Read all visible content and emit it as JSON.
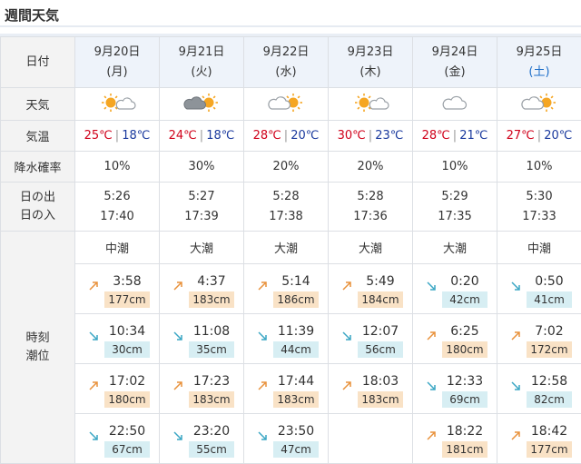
{
  "page": {
    "title": "週間天気"
  },
  "labels": {
    "date": "日付",
    "weather": "天気",
    "temp": "気温",
    "rain": "降水確率",
    "sunrise": "日の出",
    "sunset": "日の入",
    "tide_time": "時刻",
    "tide_level": "潮位"
  },
  "colors": {
    "high_temp": "#d0021b",
    "low_temp": "#1b3a9e",
    "saturday": "#1e6fc9",
    "high_tide_bg": "#f9e2c6",
    "low_tide_bg": "#d7eef3"
  },
  "days": [
    {
      "date": "9月20日",
      "dow": "(月)",
      "weather_icon": "sun-cloud-icon",
      "high": "25℃",
      "low": "18℃",
      "rain": "10%",
      "sunrise": "5:26",
      "sunset": "17:40",
      "tide_name": "中潮",
      "tides": [
        {
          "time": "3:58",
          "level": "177cm",
          "dir": "up"
        },
        {
          "time": "10:34",
          "level": "30cm",
          "dir": "down"
        },
        {
          "time": "17:02",
          "level": "180cm",
          "dir": "up"
        },
        {
          "time": "22:50",
          "level": "67cm",
          "dir": "down"
        }
      ]
    },
    {
      "date": "9月21日",
      "dow": "(火)",
      "weather_icon": "cloud-sun-icon",
      "high": "24℃",
      "low": "18℃",
      "rain": "30%",
      "sunrise": "5:27",
      "sunset": "17:39",
      "tide_name": "大潮",
      "tides": [
        {
          "time": "4:37",
          "level": "183cm",
          "dir": "up"
        },
        {
          "time": "11:08",
          "level": "35cm",
          "dir": "down"
        },
        {
          "time": "17:23",
          "level": "183cm",
          "dir": "up"
        },
        {
          "time": "23:20",
          "level": "55cm",
          "dir": "down"
        }
      ]
    },
    {
      "date": "9月22日",
      "dow": "(水)",
      "weather_icon": "cloud-sun-icon",
      "high": "28℃",
      "low": "20℃",
      "rain": "20%",
      "sunrise": "5:28",
      "sunset": "17:38",
      "tide_name": "大潮",
      "tides": [
        {
          "time": "5:14",
          "level": "186cm",
          "dir": "up"
        },
        {
          "time": "11:39",
          "level": "44cm",
          "dir": "down"
        },
        {
          "time": "17:44",
          "level": "183cm",
          "dir": "up"
        },
        {
          "time": "23:50",
          "level": "47cm",
          "dir": "down"
        }
      ]
    },
    {
      "date": "9月23日",
      "dow": "(木)",
      "weather_icon": "sun-cloud-icon",
      "high": "30℃",
      "low": "23℃",
      "rain": "20%",
      "sunrise": "5:28",
      "sunset": "17:36",
      "tide_name": "大潮",
      "tides": [
        {
          "time": "5:49",
          "level": "184cm",
          "dir": "up"
        },
        {
          "time": "12:07",
          "level": "56cm",
          "dir": "down"
        },
        {
          "time": "18:03",
          "level": "183cm",
          "dir": "up"
        },
        {
          "time": "",
          "level": "",
          "dir": "none"
        }
      ]
    },
    {
      "date": "9月24日",
      "dow": "(金)",
      "weather_icon": "cloud-icon",
      "high": "28℃",
      "low": "21℃",
      "rain": "10%",
      "sunrise": "5:29",
      "sunset": "17:35",
      "tide_name": "大潮",
      "tides": [
        {
          "time": "0:20",
          "level": "42cm",
          "dir": "down"
        },
        {
          "time": "6:25",
          "level": "180cm",
          "dir": "up"
        },
        {
          "time": "12:33",
          "level": "69cm",
          "dir": "down"
        },
        {
          "time": "18:22",
          "level": "181cm",
          "dir": "up"
        }
      ]
    },
    {
      "date": "9月25日",
      "dow": "(土)",
      "weather_icon": "cloud-sun-icon",
      "high": "27℃",
      "low": "20℃",
      "rain": "10%",
      "sunrise": "5:30",
      "sunset": "17:33",
      "tide_name": "中潮",
      "tides": [
        {
          "time": "0:50",
          "level": "41cm",
          "dir": "down"
        },
        {
          "time": "7:02",
          "level": "172cm",
          "dir": "up"
        },
        {
          "time": "12:58",
          "level": "82cm",
          "dir": "down"
        },
        {
          "time": "18:42",
          "level": "177cm",
          "dir": "up"
        }
      ]
    }
  ]
}
